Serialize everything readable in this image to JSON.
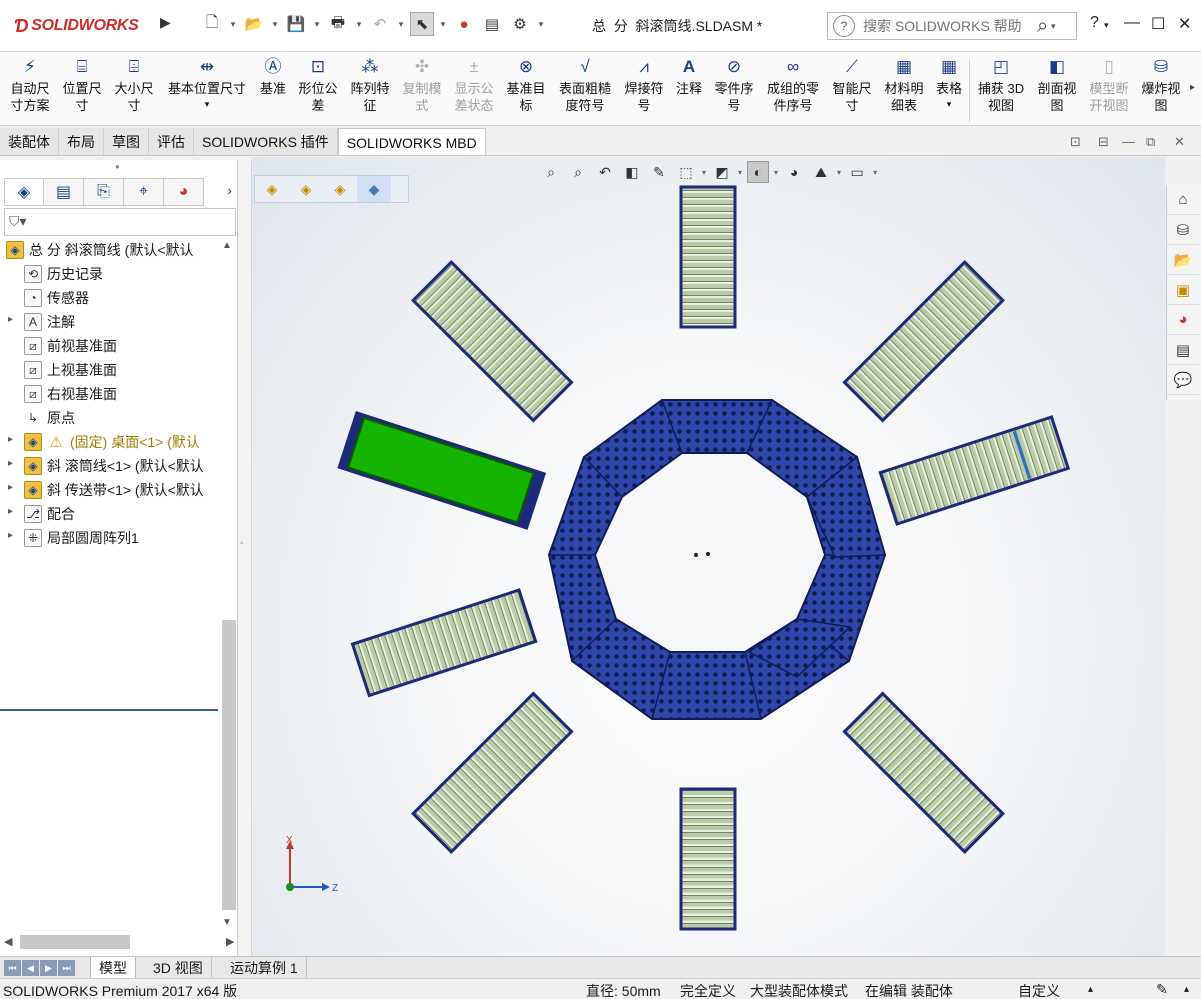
{
  "app": {
    "brand": "SOLIDWORKS",
    "doc_title": "总  分  斜滚筒线.SLDASM *",
    "search_placeholder": "搜索 SOLIDWORKS 帮助",
    "help_label": "?",
    "minimize": "—",
    "maximize": "☐",
    "close": "✕"
  },
  "commands": [
    {
      "label": "自动尺\n寸方案",
      "icon": "auto-dimension-icon",
      "enabled": true
    },
    {
      "label": "位置尺\n寸",
      "icon": "location-dimension-icon",
      "enabled": true
    },
    {
      "label": "大小尺\n寸",
      "icon": "size-dimension-icon",
      "enabled": true
    },
    {
      "label": "基本位置尺寸",
      "icon": "basic-location-dimension-icon",
      "enabled": true
    },
    {
      "label": "基准",
      "icon": "datum-icon",
      "enabled": true
    },
    {
      "label": "形位公\n差",
      "icon": "geometric-tolerance-icon",
      "enabled": true
    },
    {
      "label": "阵列特\n征",
      "icon": "pattern-feature-icon",
      "enabled": true
    },
    {
      "label": "复制模\n式",
      "icon": "copy-scheme-icon",
      "enabled": false
    },
    {
      "label": "显示公\n差状态",
      "icon": "tolerance-status-icon",
      "enabled": false
    },
    {
      "label": "基准目\n标",
      "icon": "datum-target-icon",
      "enabled": true
    },
    {
      "label": "表面粗糙\n度符号",
      "icon": "surface-finish-icon",
      "enabled": true
    },
    {
      "label": "焊接符\n号",
      "icon": "weld-symbol-icon",
      "enabled": true
    },
    {
      "label": "注释",
      "icon": "note-icon",
      "enabled": true
    },
    {
      "label": "零件序\n号",
      "icon": "balloon-icon",
      "enabled": true
    },
    {
      "label": "成组的零\n件序号",
      "icon": "stacked-balloon-icon",
      "enabled": true
    },
    {
      "label": "智能尺\n寸",
      "icon": "smart-dimension-icon",
      "enabled": true
    },
    {
      "label": "材料明\n细表",
      "icon": "bom-icon",
      "enabled": true
    },
    {
      "label": "表格",
      "icon": "table-icon",
      "enabled": true
    },
    {
      "label": "捕获 3D\n视图",
      "icon": "capture-3d-view-icon",
      "enabled": true
    },
    {
      "label": "剖面视\n图",
      "icon": "section-view-icon",
      "enabled": true
    },
    {
      "label": "模型断\n开视图",
      "icon": "broken-view-icon",
      "enabled": false
    },
    {
      "label": "爆炸视\n图",
      "icon": "exploded-view-icon",
      "enabled": true
    }
  ],
  "tabs": [
    "装配体",
    "布局",
    "草图",
    "评估",
    "SOLIDWORKS 插件",
    "SOLIDWORKS MBD"
  ],
  "active_tab": "SOLIDWORKS MBD",
  "tree": [
    {
      "label": "总  分  斜滚筒线  (默认<默认",
      "icon": "assembly-icon",
      "level": 0,
      "expand": ""
    },
    {
      "label": "历史记录",
      "icon": "history-icon",
      "level": 1,
      "expand": ""
    },
    {
      "label": "传感器",
      "icon": "sensor-icon",
      "level": 1,
      "expand": ""
    },
    {
      "label": "注解",
      "icon": "annotation-icon",
      "level": 1,
      "expand": "▸"
    },
    {
      "label": "前视基准面",
      "icon": "plane-icon",
      "level": 1,
      "expand": ""
    },
    {
      "label": "上视基准面",
      "icon": "plane-icon",
      "level": 1,
      "expand": ""
    },
    {
      "label": "右视基准面",
      "icon": "plane-icon",
      "level": 1,
      "expand": ""
    },
    {
      "label": "原点",
      "icon": "origin-icon",
      "level": 1,
      "expand": ""
    },
    {
      "label": "(固定) 桌面<1> (默认",
      "icon": "part-icon",
      "level": 1,
      "expand": "▸",
      "fixed": true
    },
    {
      "label": "斜  滚筒线<1> (默认<默认",
      "icon": "subassembly-icon",
      "level": 1,
      "expand": "▸"
    },
    {
      "label": "斜  传送带<1> (默认<默认",
      "icon": "subassembly-icon",
      "level": 1,
      "expand": "▸"
    },
    {
      "label": "配合",
      "icon": "mates-icon",
      "level": 1,
      "expand": "▸"
    },
    {
      "label": "局部圆周阵列1",
      "icon": "circular-pattern-icon",
      "level": 1,
      "expand": "▸"
    }
  ],
  "bottom_tabs": [
    "模型",
    "3D 视图",
    "运动算例 1"
  ],
  "active_bottom_tab": "模型",
  "status": {
    "product": "SOLIDWORKS Premium 2017 x64 版",
    "diameter": "直径: 50mm",
    "defined": "完全定义",
    "mode": "大型装配体模式",
    "editing": "在编辑 装配体",
    "custom": "自定义"
  },
  "triad": {
    "x_label": "X",
    "z_label": "Z"
  },
  "colors": {
    "conveyor_blue": "#2c3e9a",
    "roller_green": "#c9d9b5",
    "selected_green": "#14b400",
    "brand_red": "#d32a2a"
  }
}
